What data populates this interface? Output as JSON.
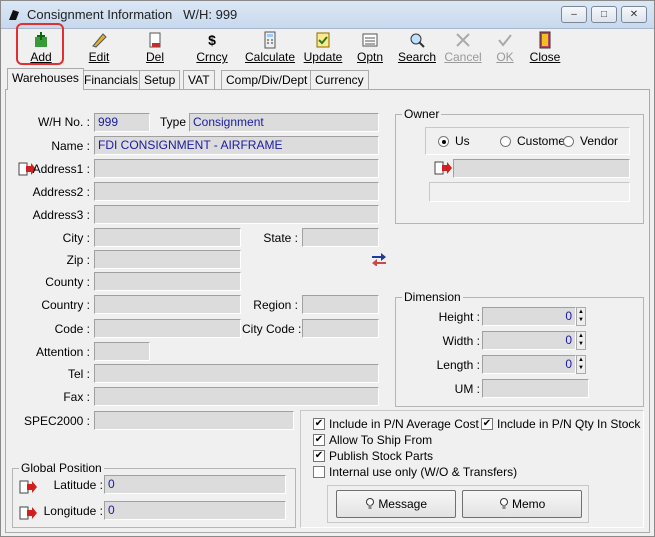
{
  "window": {
    "title": "Consignment Information",
    "wh_title": "W/H: 999"
  },
  "toolbar": {
    "add": "Add",
    "edit": "Edit",
    "del": "Del",
    "crncy": "Crncy",
    "calculate": "Calculate",
    "update": "Update",
    "optn": "Optn",
    "search": "Search",
    "cancel": "Cancel",
    "ok": "OK",
    "close": "Close"
  },
  "tabs": [
    "Warehouses",
    "Financials",
    "Setup",
    "VAT",
    "Comp/Div/Dept",
    "Currency"
  ],
  "form": {
    "wh_no_label": "W/H No. :",
    "wh_no": "999",
    "type_label": "Type",
    "type": "Consignment",
    "name_label": "Name :",
    "name": "FDI CONSIGNMENT - AIRFRAME",
    "address1_label": "Address1 :",
    "address2_label": "Address2 :",
    "address3_label": "Address3 :",
    "city_label": "City :",
    "state_label": "State :",
    "zip_label": "Zip :",
    "county_label": "County :",
    "country_label": "Country :",
    "region_label": "Region :",
    "code_label": "Code :",
    "city_code_label": "City Code :",
    "attention_label": "Attention :",
    "tel_label": "Tel :",
    "fax_label": "Fax :",
    "spec2000_label": "SPEC2000 :"
  },
  "owner": {
    "title": "Owner",
    "options": [
      "Us",
      "Customer",
      "Vendor"
    ],
    "selected": "Us"
  },
  "dimension": {
    "title": "Dimension",
    "height_label": "Height :",
    "height": "0",
    "width_label": "Width :",
    "width": "0",
    "length_label": "Length :",
    "length": "0",
    "um_label": "UM :"
  },
  "checks": {
    "avg_cost": "Include in P/N Average Cost",
    "qty_in_stock": "Include in P/N Qty In Stock",
    "allow_ship": "Allow To Ship From",
    "publish": "Publish Stock Parts",
    "internal": "Internal use only (W/O & Transfers)"
  },
  "global_position": {
    "title": "Global Position",
    "latitude_label": "Latitude :",
    "latitude": "0",
    "longitude_label": "Longitude :",
    "longitude": "0"
  },
  "buttons": {
    "message": "Message",
    "memo": "Memo"
  },
  "colors": {
    "field_value": "#1a1aa6",
    "highlight": "#e23030"
  }
}
